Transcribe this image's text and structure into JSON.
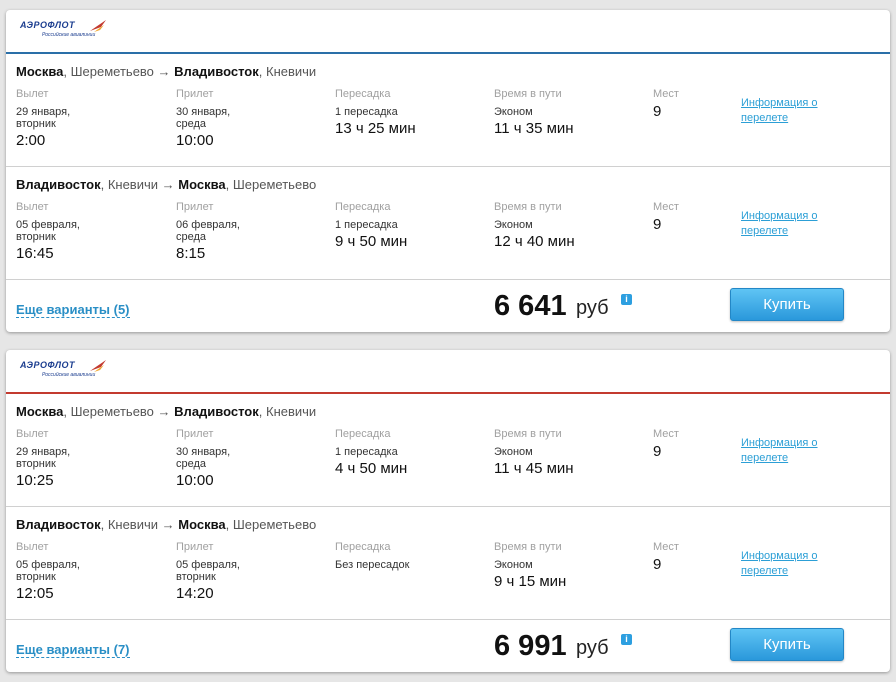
{
  "cards": [
    {
      "airline_logo": "АЭРОФЛОТ",
      "airline_logo_sub": "Российские авиалинии",
      "accent": "#2a6fa8",
      "segments": [
        {
          "from_city": "Москва",
          "from_airport": "Шереметьево",
          "to_city": "Владивосток",
          "to_airport": "Кневичи",
          "departure": {
            "label": "Вылет",
            "date": "29 января,",
            "weekday": "вторник",
            "time": "2:00"
          },
          "arrival": {
            "label": "Прилет",
            "date": "30 января,",
            "weekday": "среда",
            "time": "10:00"
          },
          "transfer": {
            "label": "Пересадка",
            "count": "1 пересадка",
            "duration": "13 ч 25 мин"
          },
          "travel": {
            "label": "Время в пути",
            "class": "Эконом",
            "duration": "11 ч 35 мин"
          },
          "seats": {
            "label": "Мест",
            "value": "9"
          },
          "info_line1": "Информация о",
          "info_line2": "перелете"
        },
        {
          "from_city": "Владивосток",
          "from_airport": "Кневичи",
          "to_city": "Москва",
          "to_airport": "Шереметьево",
          "departure": {
            "label": "Вылет",
            "date": "05 февраля,",
            "weekday": "вторник",
            "time": "16:45"
          },
          "arrival": {
            "label": "Прилет",
            "date": "06 февраля,",
            "weekday": "среда",
            "time": "8:15"
          },
          "transfer": {
            "label": "Пересадка",
            "count": "1 пересадка",
            "duration": "9 ч 50 мин"
          },
          "travel": {
            "label": "Время в пути",
            "class": "Эконом",
            "duration": "12 ч 40 мин"
          },
          "seats": {
            "label": "Мест",
            "value": "9"
          },
          "info_line1": "Информация о",
          "info_line2": "перелете"
        }
      ],
      "more_variants": "Еще варианты (5)",
      "price": "6 641",
      "currency": "руб",
      "info_icon": "i",
      "buy_label": "Купить"
    },
    {
      "airline_logo": "АЭРОФЛОТ",
      "airline_logo_sub": "Российские авиалинии",
      "accent": "#c33a2f",
      "segments": [
        {
          "from_city": "Москва",
          "from_airport": "Шереметьево",
          "to_city": "Владивосток",
          "to_airport": "Кневичи",
          "departure": {
            "label": "Вылет",
            "date": "29 января,",
            "weekday": "вторник",
            "time": "10:25"
          },
          "arrival": {
            "label": "Прилет",
            "date": "30 января,",
            "weekday": "среда",
            "time": "10:00"
          },
          "transfer": {
            "label": "Пересадка",
            "count": "1 пересадка",
            "duration": "4 ч 50 мин"
          },
          "travel": {
            "label": "Время в пути",
            "class": "Эконом",
            "duration": "11 ч 45 мин"
          },
          "seats": {
            "label": "Мест",
            "value": "9"
          },
          "info_line1": "Информация о",
          "info_line2": "перелете"
        },
        {
          "from_city": "Владивосток",
          "from_airport": "Кневичи",
          "to_city": "Москва",
          "to_airport": "Шереметьево",
          "departure": {
            "label": "Вылет",
            "date": "05 февраля,",
            "weekday": "вторник",
            "time": "12:05"
          },
          "arrival": {
            "label": "Прилет",
            "date": "05 февраля,",
            "weekday": "вторник",
            "time": "14:20"
          },
          "transfer": {
            "label": "Пересадка",
            "count": "Без пересадок",
            "duration": ""
          },
          "travel": {
            "label": "Время в пути",
            "class": "Эконом",
            "duration": "9 ч 15 мин"
          },
          "seats": {
            "label": "Мест",
            "value": "9"
          },
          "info_line1": "Информация о",
          "info_line2": "перелете"
        }
      ],
      "more_variants": "Еще варианты (7)",
      "price": "6 991",
      "currency": "руб",
      "info_icon": "i",
      "buy_label": "Купить"
    }
  ]
}
